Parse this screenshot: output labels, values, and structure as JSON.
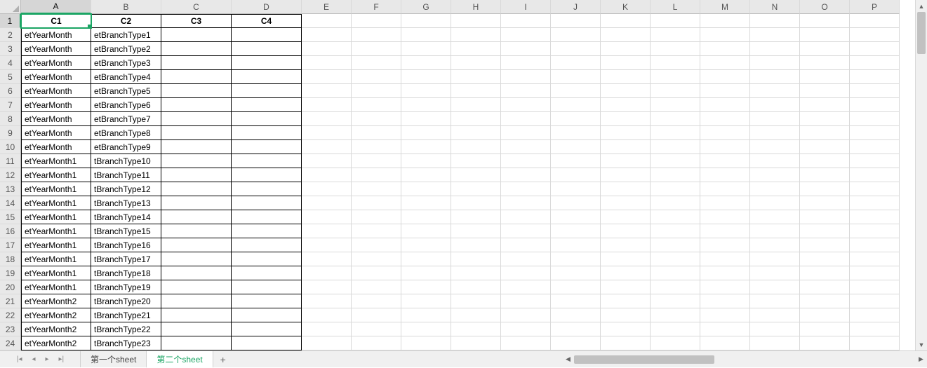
{
  "columns": [
    "A",
    "B",
    "C",
    "D",
    "E",
    "F",
    "G",
    "H",
    "I",
    "J",
    "K",
    "L",
    "M",
    "N",
    "O",
    "P"
  ],
  "rowNumbers": [
    1,
    2,
    3,
    4,
    5,
    6,
    7,
    8,
    9,
    10,
    11,
    12,
    13,
    14,
    15,
    16,
    17,
    18,
    19,
    20,
    21,
    22,
    23,
    24
  ],
  "headerRow": [
    "C1",
    "C2",
    "C3",
    "C4"
  ],
  "dataRows": [
    {
      "a": "etYearMonth",
      "b": "etBranchType1"
    },
    {
      "a": "etYearMonth",
      "b": "etBranchType2"
    },
    {
      "a": "etYearMonth",
      "b": "etBranchType3"
    },
    {
      "a": "etYearMonth",
      "b": "etBranchType4"
    },
    {
      "a": "etYearMonth",
      "b": "etBranchType5"
    },
    {
      "a": "etYearMonth",
      "b": "etBranchType6"
    },
    {
      "a": "etYearMonth",
      "b": "etBranchType7"
    },
    {
      "a": "etYearMonth",
      "b": "etBranchType8"
    },
    {
      "a": "etYearMonth",
      "b": "etBranchType9"
    },
    {
      "a": "etYearMonth1",
      "b": "tBranchType10"
    },
    {
      "a": "etYearMonth1",
      "b": "tBranchType11"
    },
    {
      "a": "etYearMonth1",
      "b": "tBranchType12"
    },
    {
      "a": "etYearMonth1",
      "b": "tBranchType13"
    },
    {
      "a": "etYearMonth1",
      "b": "tBranchType14"
    },
    {
      "a": "etYearMonth1",
      "b": "tBranchType15"
    },
    {
      "a": "etYearMonth1",
      "b": "tBranchType16"
    },
    {
      "a": "etYearMonth1",
      "b": "tBranchType17"
    },
    {
      "a": "etYearMonth1",
      "b": "tBranchType18"
    },
    {
      "a": "etYearMonth1",
      "b": "tBranchType19"
    },
    {
      "a": "etYearMonth2",
      "b": "tBranchType20"
    },
    {
      "a": "etYearMonth2",
      "b": "tBranchType21"
    },
    {
      "a": "etYearMonth2",
      "b": "tBranchType22"
    },
    {
      "a": "etYearMonth2",
      "b": "tBranchType23"
    }
  ],
  "sheetTabs": {
    "tab1": "第一个sheet",
    "tab2": "第二个sheet"
  },
  "activeSheetIndex": 1,
  "selectedCell": "A1",
  "icons": {
    "navFirst": "|◂",
    "navPrev": "◂",
    "navNext": "▸",
    "navLast": "▸|",
    "scrollUp": "▲",
    "scrollDown": "▼",
    "scrollLeft": "◀",
    "scrollRight": "▶",
    "add": "+"
  }
}
